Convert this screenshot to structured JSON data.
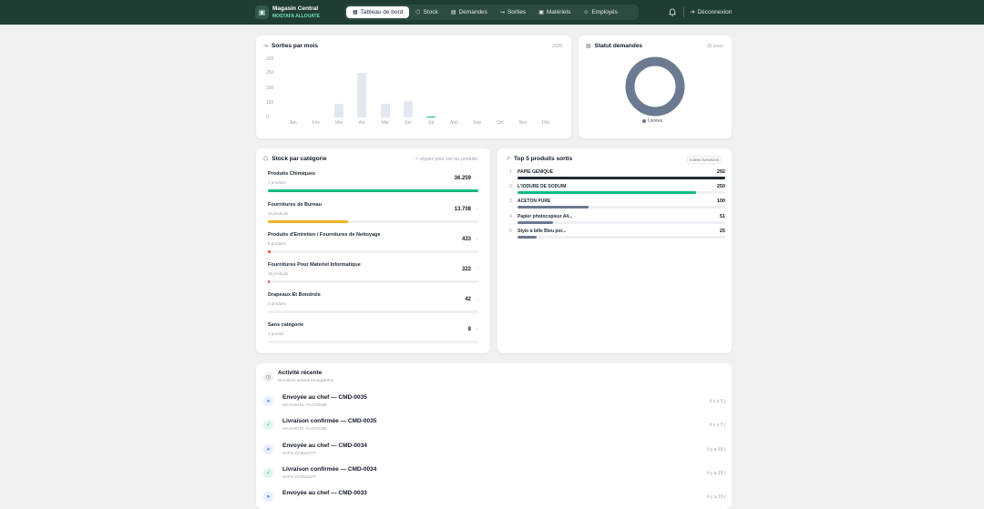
{
  "brand": {
    "name": "Magasin Central",
    "user": "MOSTAFA ALLOUATE"
  },
  "nav": [
    {
      "label": "Tableau de bord",
      "icon": "dashboard-icon",
      "glyph": "▦",
      "active": true
    },
    {
      "label": "Stock",
      "icon": "box-icon",
      "glyph": "⬡",
      "active": false
    },
    {
      "label": "Demandes",
      "icon": "document-icon",
      "glyph": "▤",
      "active": false
    },
    {
      "label": "Sorties",
      "icon": "trend-icon",
      "glyph": "↝",
      "active": false
    },
    {
      "label": "Matériels",
      "icon": "calendar-icon",
      "glyph": "▣",
      "active": false
    },
    {
      "label": "Employés",
      "icon": "users-icon",
      "glyph": "☺",
      "active": false
    }
  ],
  "header": {
    "logout_label": "Déconnexion"
  },
  "sorties": {
    "title": "Sorties par mois",
    "year": "2026"
  },
  "chart_data": {
    "type": "bar",
    "title": "Sorties par mois",
    "categories": [
      "Jan",
      "Fév",
      "Mar",
      "Avr",
      "Mai",
      "Jun",
      "Jul",
      "Aoû",
      "Sep",
      "Oct",
      "Nov",
      "Déc"
    ],
    "values": [
      0,
      0,
      68,
      228,
      68,
      82,
      4,
      0,
      0,
      0,
      0,
      0
    ],
    "ylim": [
      0,
      300
    ],
    "yticks": [
      "300",
      "250",
      "200",
      "150",
      "0"
    ],
    "colors": {
      "bar": "#e3e8f0",
      "current": "#10b981"
    },
    "current_index": 6
  },
  "statut": {
    "title": "Statut demandes",
    "period": "30 jours",
    "legend": "Livrées",
    "color": "#6b7a90"
  },
  "stock": {
    "title": "Stock par catégorie",
    "hint": "↗ cliquez pour voir les produits",
    "items": [
      {
        "name": "Produits Chimiques",
        "sub": "7 produits",
        "value": "36.259",
        "fraction": 1.0,
        "color": "#10b981"
      },
      {
        "name": "Fournitures de Bureau",
        "sub": "34 produits",
        "value": "13.708",
        "fraction": 0.38,
        "color": "#f0b323"
      },
      {
        "name": "Produits d'Entretien / Fournitures de Nettoyage",
        "sub": "6 produits",
        "value": "433",
        "fraction": 0.012,
        "color": "#ef4444"
      },
      {
        "name": "Fournitures Pour Materiel Informatique",
        "sub": "28 produits",
        "value": "322",
        "fraction": 0.009,
        "color": "#ef4444"
      },
      {
        "name": "Drapeaux Et Bondrols",
        "sub": "2 produits",
        "value": "42",
        "fraction": 0.0,
        "color": "#ef4444"
      },
      {
        "name": "Sans catégorie",
        "sub": "1 produit",
        "value": "8",
        "fraction": 0.0,
        "color": "#ef4444"
      }
    ]
  },
  "top5": {
    "title": "Top 5 produits sortis",
    "badge": "toutes livraisons",
    "items": [
      {
        "rank": "1",
        "name": "PAPIE GENIQUE",
        "value": "292",
        "fraction": 1.0,
        "color": "#1f2937"
      },
      {
        "rank": "2",
        "name": "L'IODURE DE SODUIM",
        "value": "250",
        "fraction": 0.86,
        "color": "#10b981"
      },
      {
        "rank": "3",
        "name": "ACETON PURE",
        "value": "100",
        "fraction": 0.34,
        "color": "#6b7a90"
      },
      {
        "rank": "4",
        "name": "Papier photocopieur A4...",
        "value": "51",
        "fraction": 0.17,
        "color": "#6b7a90"
      },
      {
        "rank": "5",
        "name": "Stylo à bille Bleu por...",
        "value": "25",
        "fraction": 0.09,
        "color": "#6b7a90"
      }
    ]
  },
  "activite": {
    "title": "Activité récente",
    "subtitle": "Dernières actions enregistrées",
    "items": [
      {
        "type": "send",
        "title": "Envoyée au chef — CMD-0035",
        "user": "HICHAM EL YAAGOUBI",
        "time": "il y a 5 j"
      },
      {
        "type": "done",
        "title": "Livraison confirmée — CMD-0035",
        "user": "HICHAM EL YAAGOUBI",
        "time": "il y a 5 j"
      },
      {
        "type": "send",
        "title": "Envoyée au chef — CMD-0034",
        "user": "SAFIA DOBLEDIT",
        "time": "il y a 18 j"
      },
      {
        "type": "done",
        "title": "Livraison confirmée — CMD-0034",
        "user": "SAFIA DOBLEDIT",
        "time": "il y a 18 j"
      },
      {
        "type": "send",
        "title": "Envoyée au chef — CMD-0033",
        "user": "",
        "time": "il y a 19 j"
      }
    ]
  }
}
